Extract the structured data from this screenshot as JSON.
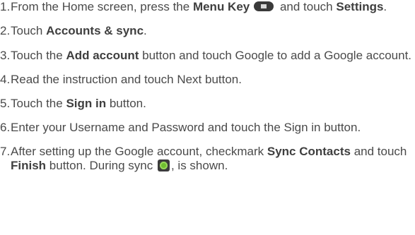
{
  "steps": [
    {
      "num": "1.",
      "t1": "From the Home screen, press the ",
      "b1": "Menu Key",
      "t2": " and touch ",
      "b2": "Settings",
      "t3": "."
    },
    {
      "num": "2.",
      "t1": "Touch ",
      "b1": "Accounts & sync",
      "t2": "."
    },
    {
      "num": "3.",
      "t1": "Touch the ",
      "b1": "Add account",
      "t2": " button and touch Google to add a Google account."
    },
    {
      "num": "4.",
      "t1": "Read the instruction and touch Next button."
    },
    {
      "num": "5.",
      "t1": "Touch the ",
      "b1": "Sign in",
      "t2": " button."
    },
    {
      "num": "6.",
      "t1": "Enter your Username and Password and touch the Sign in button."
    },
    {
      "num": "7.",
      "t1": "After setting up the Google account, checkmark ",
      "b1": "Sync Contacts",
      "t2": " and touch ",
      "b2": "Finish",
      "t3": " button. During sync ",
      "t4": ", is shown."
    }
  ],
  "icons": {
    "menu_key": "menu-key-icon",
    "sync": "sync-icon",
    "sync_color": "#6fbf2f"
  }
}
